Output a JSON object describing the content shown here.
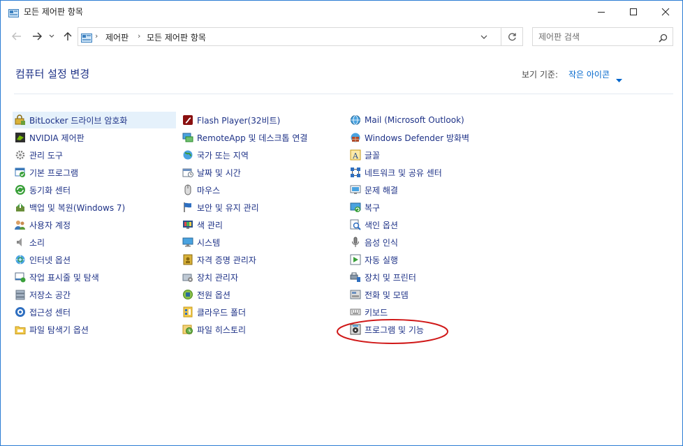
{
  "window": {
    "title": "모든 제어판 항목"
  },
  "nav": {
    "back": "←",
    "forward": "→",
    "recent": "˅",
    "up": "↑"
  },
  "breadcrumb": {
    "items": [
      "제어판",
      "모든 제어판 항목"
    ],
    "separator": "›"
  },
  "search": {
    "placeholder": "제어판 검색",
    "value": ""
  },
  "header": {
    "title": "컴퓨터 설정 변경",
    "view_by_label": "보기 기준:",
    "view_by_value": "작은 아이콘"
  },
  "colors": {
    "link": "#1e3287",
    "accent": "#0066cc",
    "hover_bg": "#e5f1fb",
    "annotation": "#d01818"
  },
  "columns": [
    {
      "items": [
        {
          "label": "BitLocker 드라이브 암호화",
          "icon": "bitlocker-icon"
        },
        {
          "label": "NVIDIA 제어판",
          "icon": "nvidia-icon"
        },
        {
          "label": "관리 도구",
          "icon": "admin-tools-icon"
        },
        {
          "label": "기본 프로그램",
          "icon": "default-programs-icon"
        },
        {
          "label": "동기화 센터",
          "icon": "sync-center-icon"
        },
        {
          "label": "백업 및 복원(Windows 7)",
          "icon": "backup-restore-icon"
        },
        {
          "label": "사용자 계정",
          "icon": "user-accounts-icon"
        },
        {
          "label": "소리",
          "icon": "sound-icon"
        },
        {
          "label": "인터넷 옵션",
          "icon": "internet-options-icon"
        },
        {
          "label": "작업 표시줄 및 탐색",
          "icon": "taskbar-icon"
        },
        {
          "label": "저장소 공간",
          "icon": "storage-spaces-icon"
        },
        {
          "label": "접근성 센터",
          "icon": "ease-of-access-icon"
        },
        {
          "label": "파일 탐색기 옵션",
          "icon": "folder-options-icon"
        }
      ]
    },
    {
      "items": [
        {
          "label": "Flash Player(32비트)",
          "icon": "flash-icon"
        },
        {
          "label": "RemoteApp 및 데스크톱 연결",
          "icon": "remoteapp-icon"
        },
        {
          "label": "국가 또는 지역",
          "icon": "region-icon"
        },
        {
          "label": "날짜 및 시간",
          "icon": "date-time-icon"
        },
        {
          "label": "마우스",
          "icon": "mouse-icon"
        },
        {
          "label": "보안 및 유지 관리",
          "icon": "security-flag-icon"
        },
        {
          "label": "색 관리",
          "icon": "color-management-icon"
        },
        {
          "label": "시스템",
          "icon": "system-icon"
        },
        {
          "label": "자격 증명 관리자",
          "icon": "credential-manager-icon"
        },
        {
          "label": "장치 관리자",
          "icon": "device-manager-icon"
        },
        {
          "label": "전원 옵션",
          "icon": "power-options-icon"
        },
        {
          "label": "클라우드 폴더",
          "icon": "work-folders-icon"
        },
        {
          "label": "파일 히스토리",
          "icon": "file-history-icon"
        }
      ]
    },
    {
      "items": [
        {
          "label": "Mail (Microsoft Outlook)",
          "icon": "mail-icon"
        },
        {
          "label": "Windows Defender 방화벽",
          "icon": "firewall-icon"
        },
        {
          "label": "글꼴",
          "icon": "fonts-icon"
        },
        {
          "label": "네트워크 및 공유 센터",
          "icon": "network-icon"
        },
        {
          "label": "문제 해결",
          "icon": "troubleshooting-icon"
        },
        {
          "label": "복구",
          "icon": "recovery-icon"
        },
        {
          "label": "색인 옵션",
          "icon": "indexing-icon"
        },
        {
          "label": "음성 인식",
          "icon": "speech-icon"
        },
        {
          "label": "자동 실행",
          "icon": "autoplay-icon"
        },
        {
          "label": "장치 및 프린터",
          "icon": "devices-printers-icon"
        },
        {
          "label": "전화 및 모뎀",
          "icon": "phone-modem-icon"
        },
        {
          "label": "키보드",
          "icon": "keyboard-icon"
        },
        {
          "label": "프로그램 및 기능",
          "icon": "programs-features-icon"
        }
      ]
    }
  ]
}
